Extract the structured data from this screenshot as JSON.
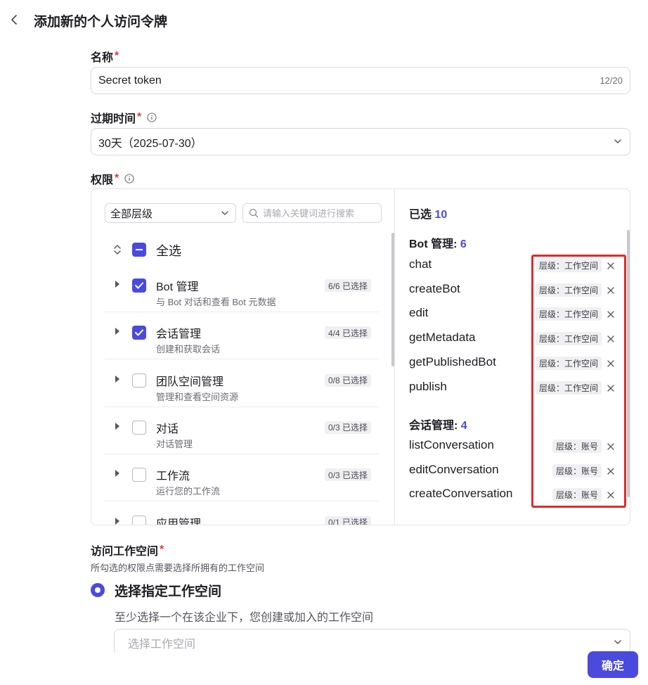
{
  "page": {
    "title": "添加新的个人访问令牌"
  },
  "name_field": {
    "label": "名称",
    "value": "Secret token",
    "counter": "12/20"
  },
  "expiry_field": {
    "label": "过期时间",
    "value": "30天（2025-07-30）"
  },
  "permissions": {
    "label": "权限",
    "scope_filter": "全部层级",
    "search_placeholder": "请输入关键词进行搜索",
    "select_all_label": "全选",
    "items": [
      {
        "name": "Bot 管理",
        "desc": "与 Bot 对话和查看 Bot 元数据",
        "badge": "6/6 已选择",
        "checked": true
      },
      {
        "name": "会话管理",
        "desc": "创建和获取会话",
        "badge": "4/4 已选择",
        "checked": true
      },
      {
        "name": "团队空间管理",
        "desc": "管理和查看空间资源",
        "badge": "0/8 已选择",
        "checked": false
      },
      {
        "name": "对话",
        "desc": "对话管理",
        "badge": "0/3 已选择",
        "checked": false
      },
      {
        "name": "工作流",
        "desc": "运行您的工作流",
        "badge": "0/3 已选择",
        "checked": false
      },
      {
        "name": "应用管理",
        "desc": "",
        "badge": "0/1 已选择",
        "checked": false
      }
    ],
    "selected_label": "已选",
    "selected_count": "10",
    "groups": [
      {
        "title": "Bot 管理:",
        "count": "6",
        "perms": [
          {
            "name": "chat",
            "tag": "层级：工作空间"
          },
          {
            "name": "createBot",
            "tag": "层级：工作空间"
          },
          {
            "name": "edit",
            "tag": "层级：工作空间"
          },
          {
            "name": "getMetadata",
            "tag": "层级：工作空间"
          },
          {
            "name": "getPublishedBot",
            "tag": "层级：工作空间"
          },
          {
            "name": "publish",
            "tag": "层级：工作空间"
          }
        ]
      },
      {
        "title": "会话管理:",
        "count": "4",
        "perms": [
          {
            "name": "listConversation",
            "tag": "层级：账号"
          },
          {
            "name": "editConversation",
            "tag": "层级：账号"
          },
          {
            "name": "createConversation",
            "tag": "层级：账号"
          }
        ]
      }
    ]
  },
  "workspace": {
    "label": "访问工作空间",
    "sublabel": "所勾选的权限点需要选择所拥有的工作空间",
    "radio_label": "选择指定工作空间",
    "hint": "至少选择一个在该企业下，您创建或加入的工作空间",
    "placeholder": "选择工作空间"
  },
  "footer": {
    "confirm_label": "确定"
  },
  "colors": {
    "accent": "#4b4adf",
    "required": "#e53935",
    "highlight": "#e02b2b"
  }
}
